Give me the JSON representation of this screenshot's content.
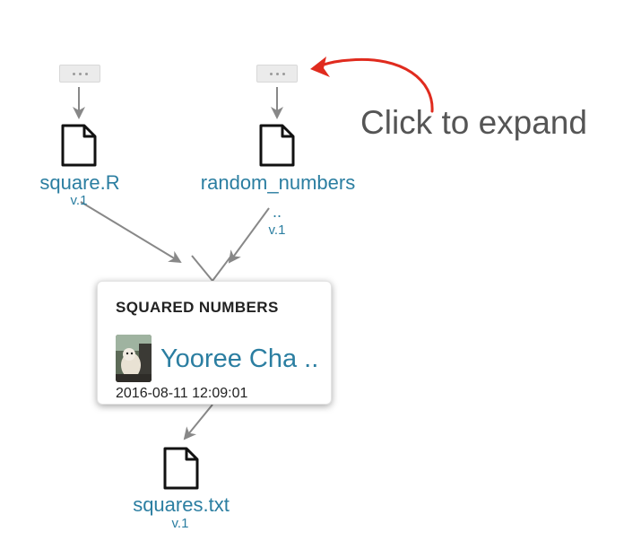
{
  "nodes": {
    "square_r": {
      "label": "square.R",
      "version": "v.1"
    },
    "random_numbers": {
      "label": "random_numbers",
      "ellipsis": "..",
      "version": "v.1"
    },
    "squares_txt": {
      "label": "squares.txt",
      "version": "v.1"
    }
  },
  "activity": {
    "title": "SQUARED NUMBERS",
    "author": "Yooree Cha ..",
    "timestamp": "2016-08-11 12:09:01"
  },
  "annotation": {
    "text": "Click to expand"
  },
  "icons": {
    "expand": "more-dots-icon",
    "file": "file-icon",
    "avatar": "user-avatar"
  },
  "colors": {
    "link": "#2b7ea1",
    "annotation_arrow": "#e02b1e",
    "edge": "#888888"
  }
}
